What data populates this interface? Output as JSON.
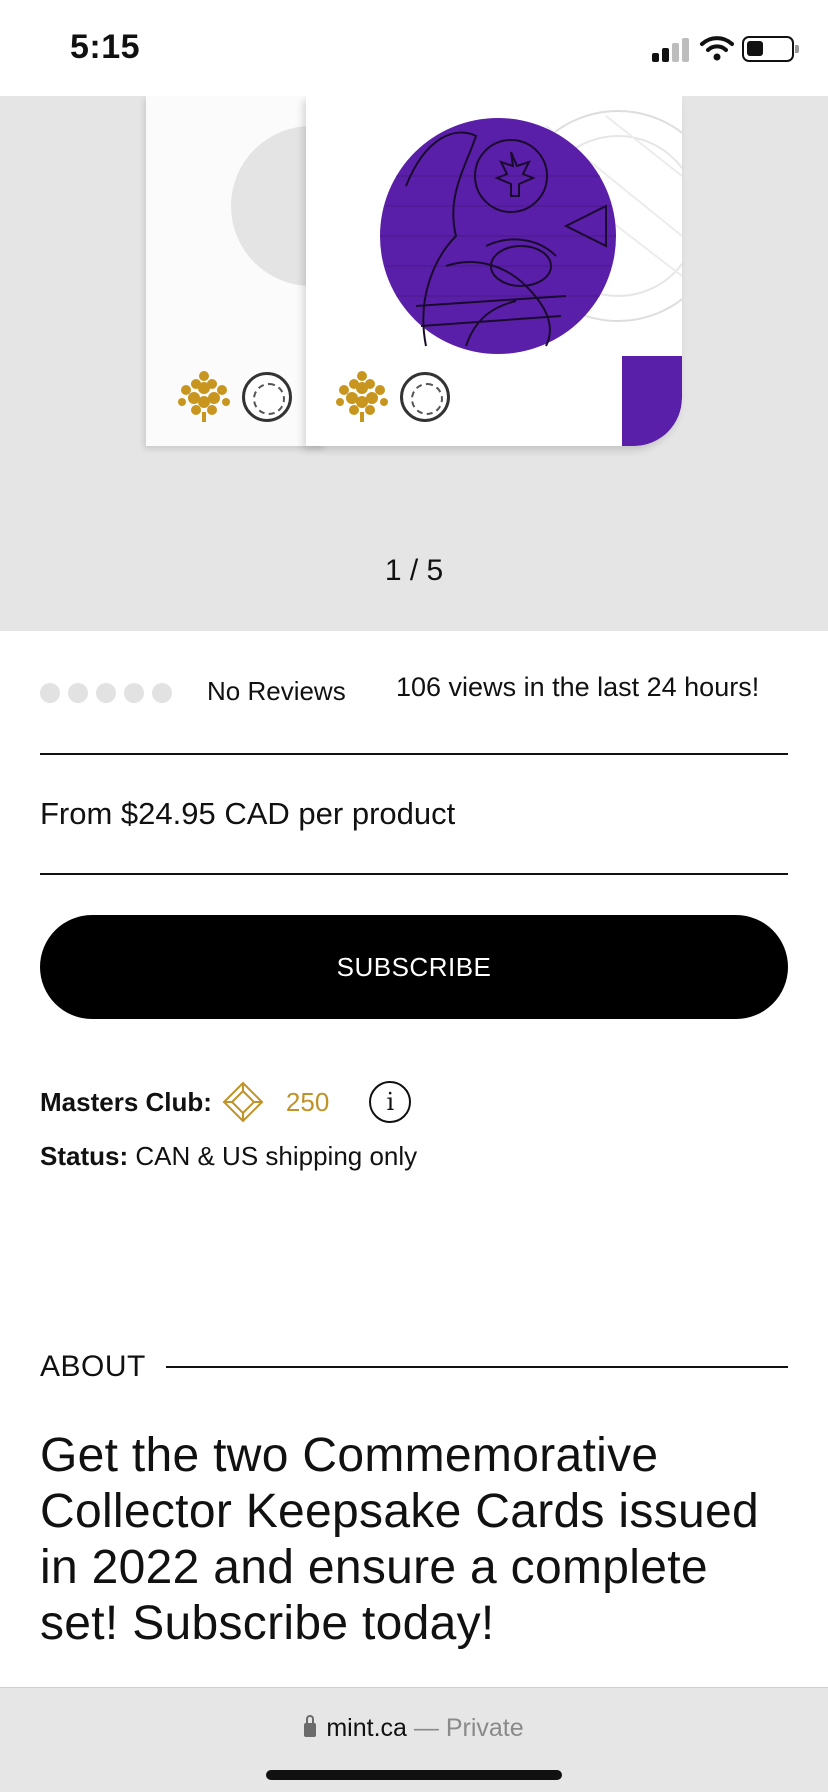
{
  "status_bar": {
    "time": "5:15",
    "icons": [
      "cellular-signal-icon",
      "wifi-icon",
      "battery-icon"
    ]
  },
  "gallery": {
    "counter": "1 / 5",
    "colors": {
      "background": "#e5e5e5",
      "coin_purple": "#5a1fa8",
      "maple_gold": "#c8961e"
    }
  },
  "reviews": {
    "rating": 0,
    "rating_max": 5,
    "label": "No Reviews",
    "views": "106 views in the last 24 hours!"
  },
  "price": {
    "text": "From $24.95 CAD per product"
  },
  "subscribe_button": {
    "label": "SUBSCRIBE"
  },
  "masters_club": {
    "label": "Masters Club:",
    "points": "250",
    "points_color": "#c09228",
    "icons": [
      "diamond-points-icon",
      "info-icon"
    ]
  },
  "status": {
    "label": "Status:",
    "value": "CAN & US shipping only"
  },
  "about": {
    "heading": "ABOUT",
    "text": "Get the two Commemorative Collector Keepsake Cards issued in 2022 and ensure a complete set! Subscribe today!"
  },
  "browser": {
    "domain": "mint.ca",
    "separator": "—",
    "mode": "Private"
  }
}
